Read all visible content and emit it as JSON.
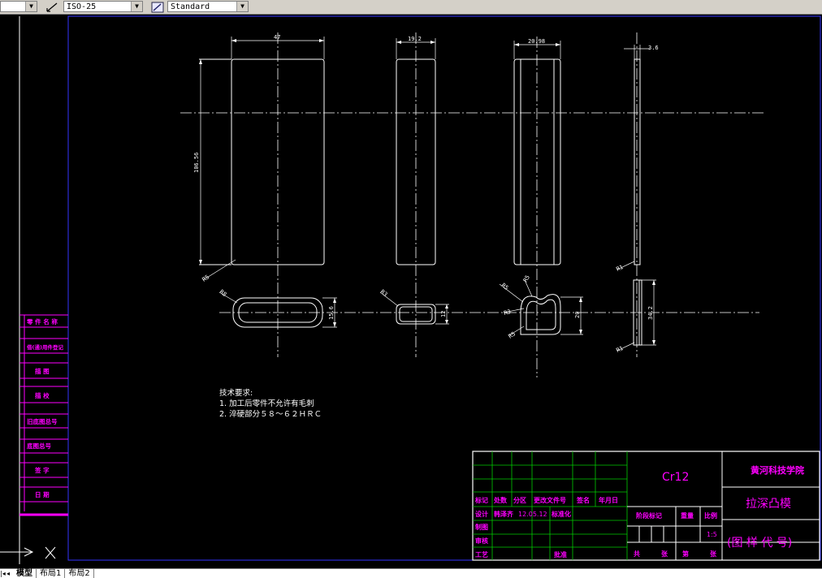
{
  "toolbar": {
    "dim_style": "ISO-25",
    "text_style": "Standard"
  },
  "drawing": {
    "dims": {
      "d47": "47",
      "d19_2": "19.2",
      "d20_98": "20.98",
      "d3_6": "3.6",
      "d106_56": "106.56",
      "d15_6": "15.6",
      "d20": "20",
      "d34_2": "34.2",
      "r5": "R5",
      "r8": "R8",
      "r3": "R3",
      "r1": "R1"
    },
    "notes": {
      "title": "技术要求:",
      "line1": "1. 加工后零件不允许有毛刺",
      "line2": "2. 淬硬部分５８～６２ＨＲＣ"
    },
    "side_labels": [
      "零 件 名 称",
      "借(通)用件登记",
      "描 图",
      "描 校",
      "旧底图总号",
      "底图总号",
      "签 字",
      "日 期"
    ],
    "title_block": {
      "material": "Cr12",
      "company": "黄河科技学院",
      "part_name": "拉深凸模",
      "drawing_code": "(图 样 代 号)",
      "scale": "1:5",
      "h_biaoji": "标记",
      "h_chushu": "处数",
      "h_fenqu": "分区",
      "h_gengai": "更改文件号",
      "h_qianming": "签名",
      "h_nianyueri": "年月日",
      "sheji": "设计",
      "designer": "韩泽齐",
      "date": "12.05.12",
      "biaozhunhua": "标准化",
      "zhitu": "制图",
      "shenhe": "审核",
      "gongyi": "工艺",
      "pizhun": "批准",
      "jieduan": "阶段标记",
      "zhongliang": "重量",
      "bili": "比例",
      "gong": "共",
      "zhang1": "张",
      "di": "第",
      "zhang2": "张"
    }
  },
  "layout_tabs": [
    "模型",
    "布局1",
    "布局2"
  ]
}
